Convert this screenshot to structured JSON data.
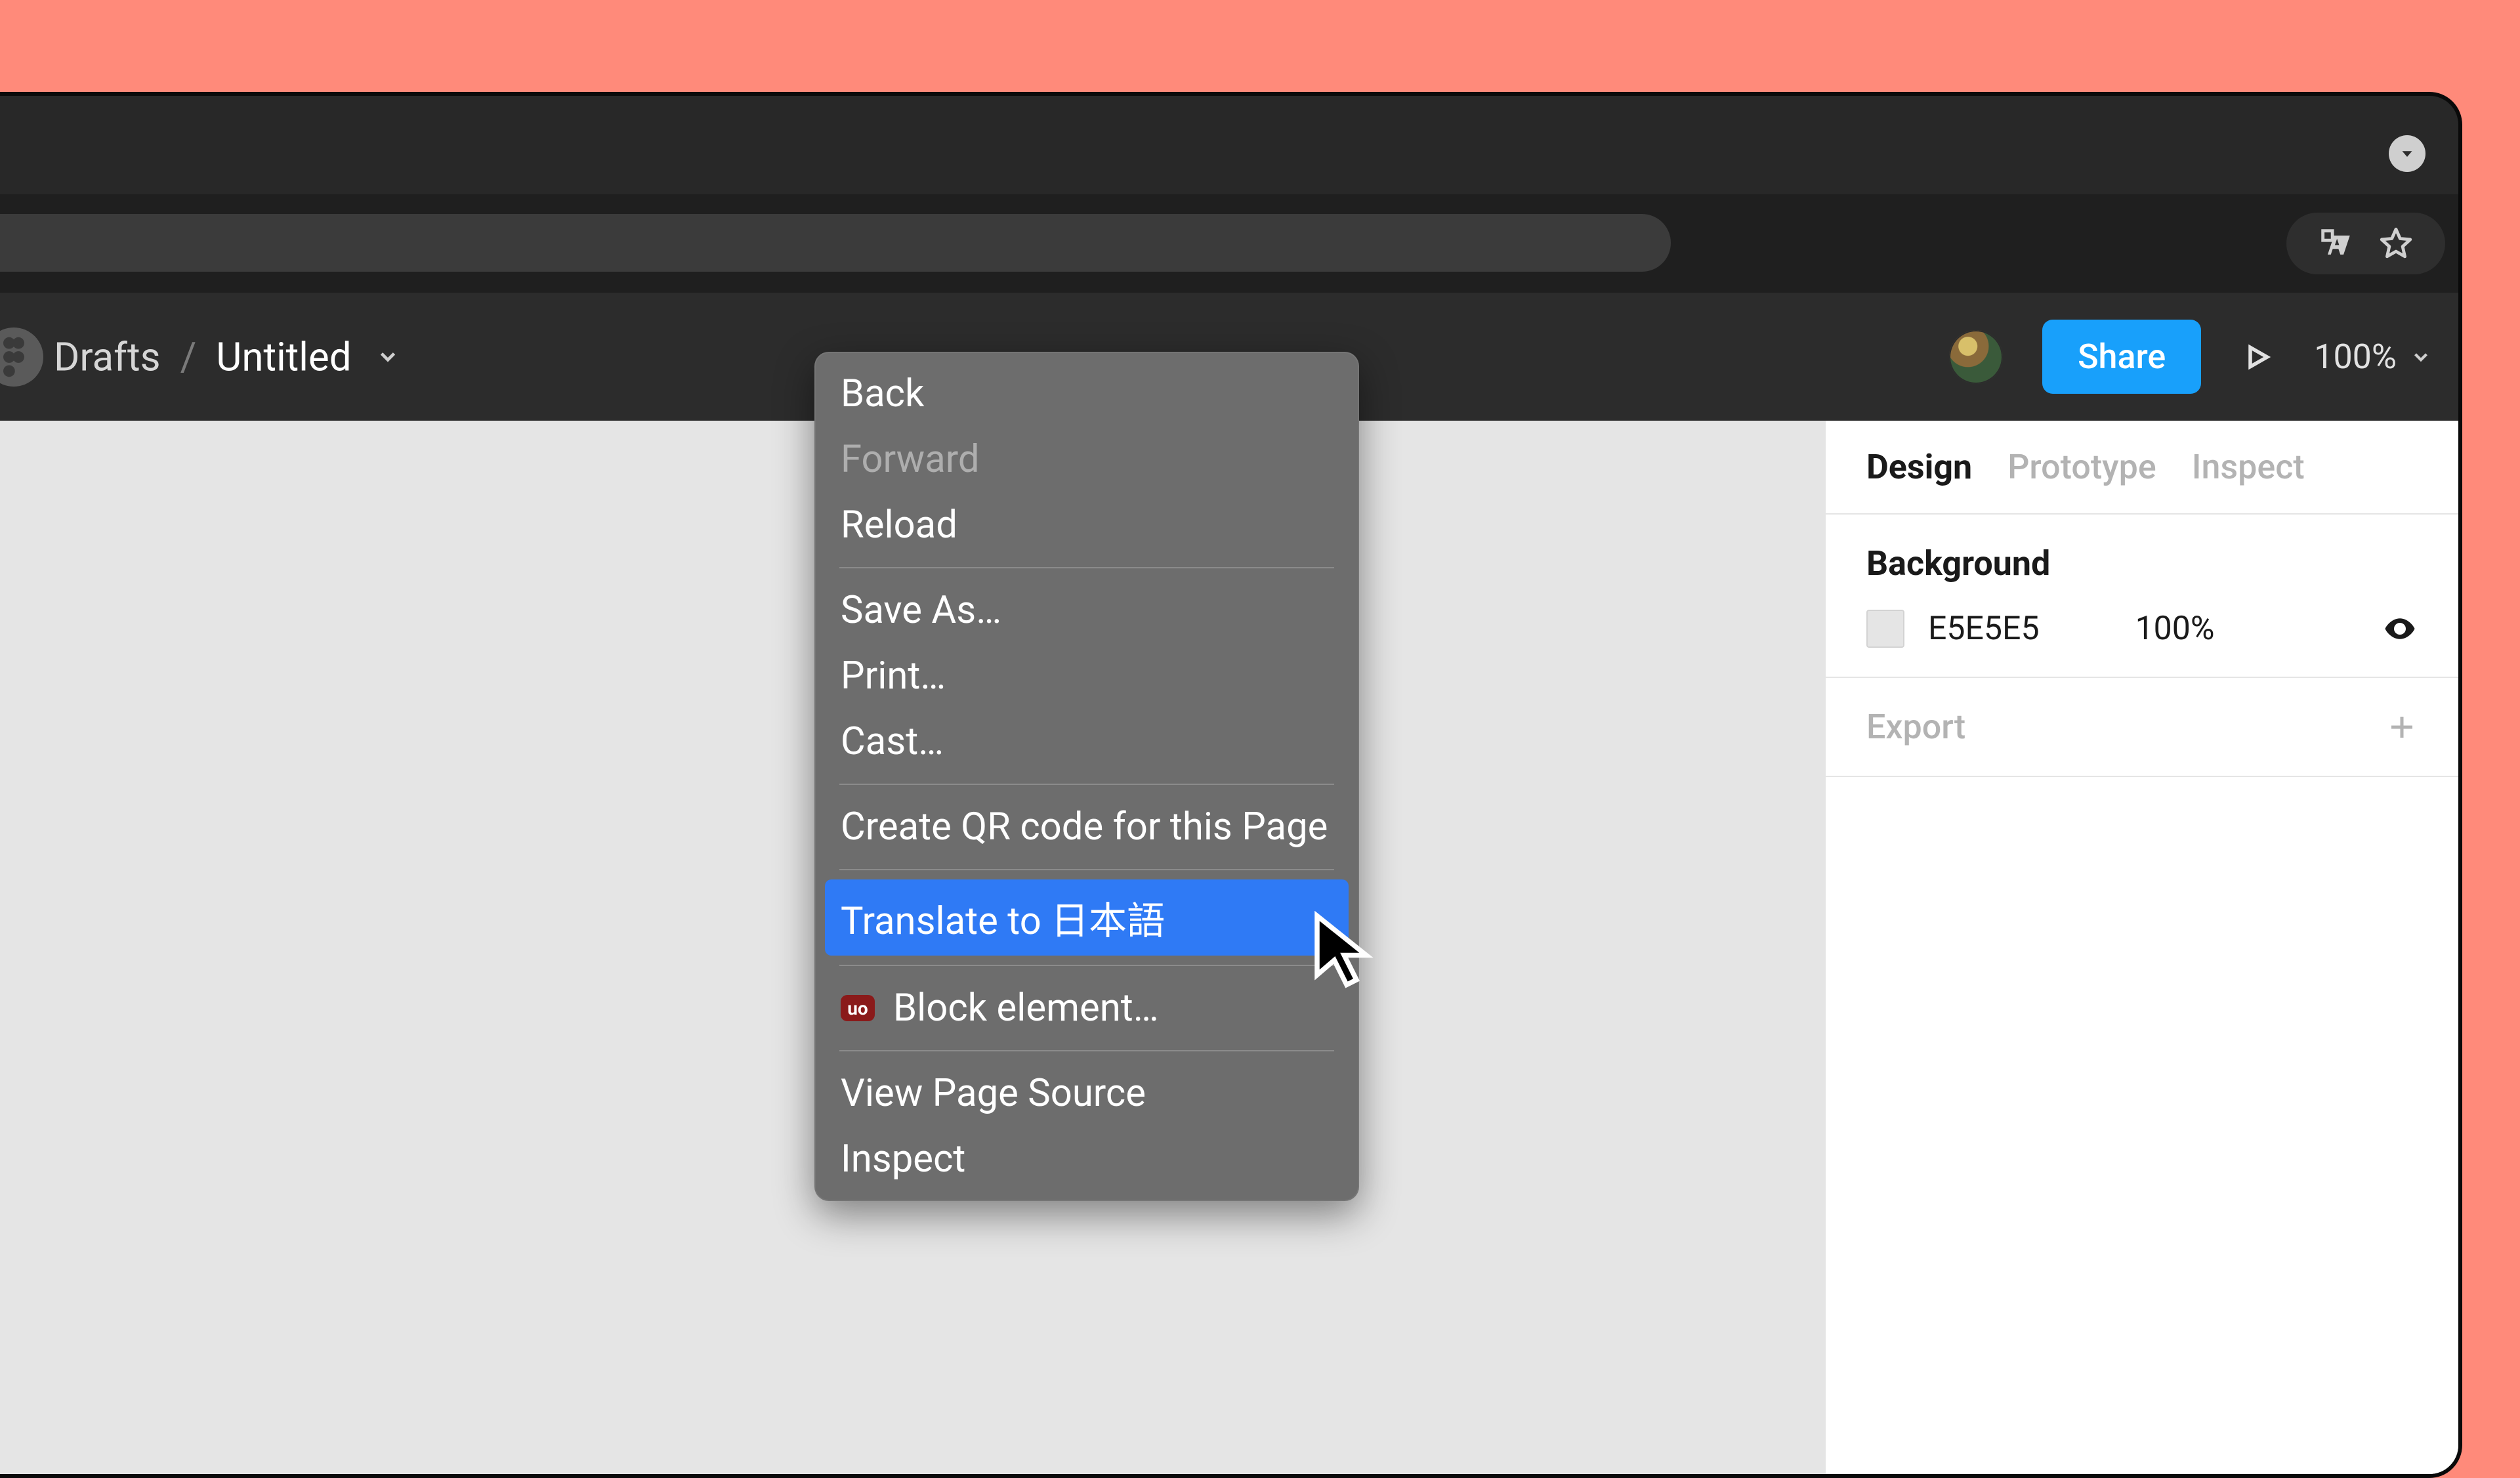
{
  "breadcrumb": {
    "project": "Drafts",
    "separator": "/",
    "file": "Untitled"
  },
  "toolbar": {
    "share_label": "Share",
    "zoom_label": "100%"
  },
  "panel": {
    "tabs": {
      "design": "Design",
      "prototype": "Prototype",
      "inspect": "Inspect"
    },
    "background": {
      "title": "Background",
      "hex": "E5E5E5",
      "opacity": "100%"
    },
    "export": {
      "title": "Export"
    }
  },
  "context_menu": {
    "back": "Back",
    "forward": "Forward",
    "reload": "Reload",
    "save_as": "Save As…",
    "print": "Print…",
    "cast": "Cast…",
    "qr": "Create QR code for this Page",
    "translate": "Translate to 日本語",
    "ublock_badge": "uo",
    "block_element": "Block element…",
    "view_source": "View Page Source",
    "inspect": "Inspect"
  }
}
